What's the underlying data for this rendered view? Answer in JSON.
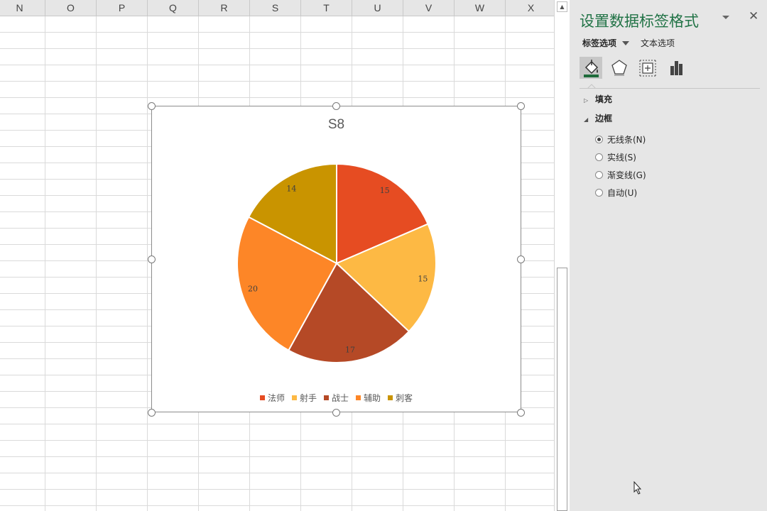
{
  "sheet": {
    "columns": [
      "N",
      "O",
      "P",
      "Q",
      "R",
      "S",
      "T",
      "U",
      "V",
      "W",
      "X"
    ]
  },
  "chart": {
    "title": "S8"
  },
  "chart_data": {
    "type": "pie",
    "title": "S8",
    "categories": [
      "法师",
      "射手",
      "战士",
      "辅助",
      "刺客"
    ],
    "values": [
      15,
      15,
      17,
      20,
      14
    ],
    "colors": [
      "#e64c22",
      "#fdb944",
      "#b54926",
      "#fd8627",
      "#c99400"
    ],
    "data_labels": [
      "15",
      "15",
      "17",
      "20",
      "14"
    ],
    "legend_position": "bottom"
  },
  "pane": {
    "title": "设置数据标签格式",
    "close_symbol": "✕",
    "tabs": {
      "label_options": "标签选项",
      "text_options": "文本选项"
    },
    "icons": [
      "fill-line-icon",
      "effects-pentagon-icon",
      "size-properties-icon",
      "label-options-bar-icon"
    ],
    "sections": [
      {
        "label": "填充",
        "expanded": false
      },
      {
        "label": "边框",
        "expanded": true
      }
    ],
    "border_options": [
      {
        "label": "无线条(N)",
        "checked": true
      },
      {
        "label": "实线(S)",
        "checked": false
      },
      {
        "label": "渐变线(G)",
        "checked": false
      },
      {
        "label": "自动(U)",
        "checked": false
      }
    ],
    "accent_color": "#217346"
  }
}
